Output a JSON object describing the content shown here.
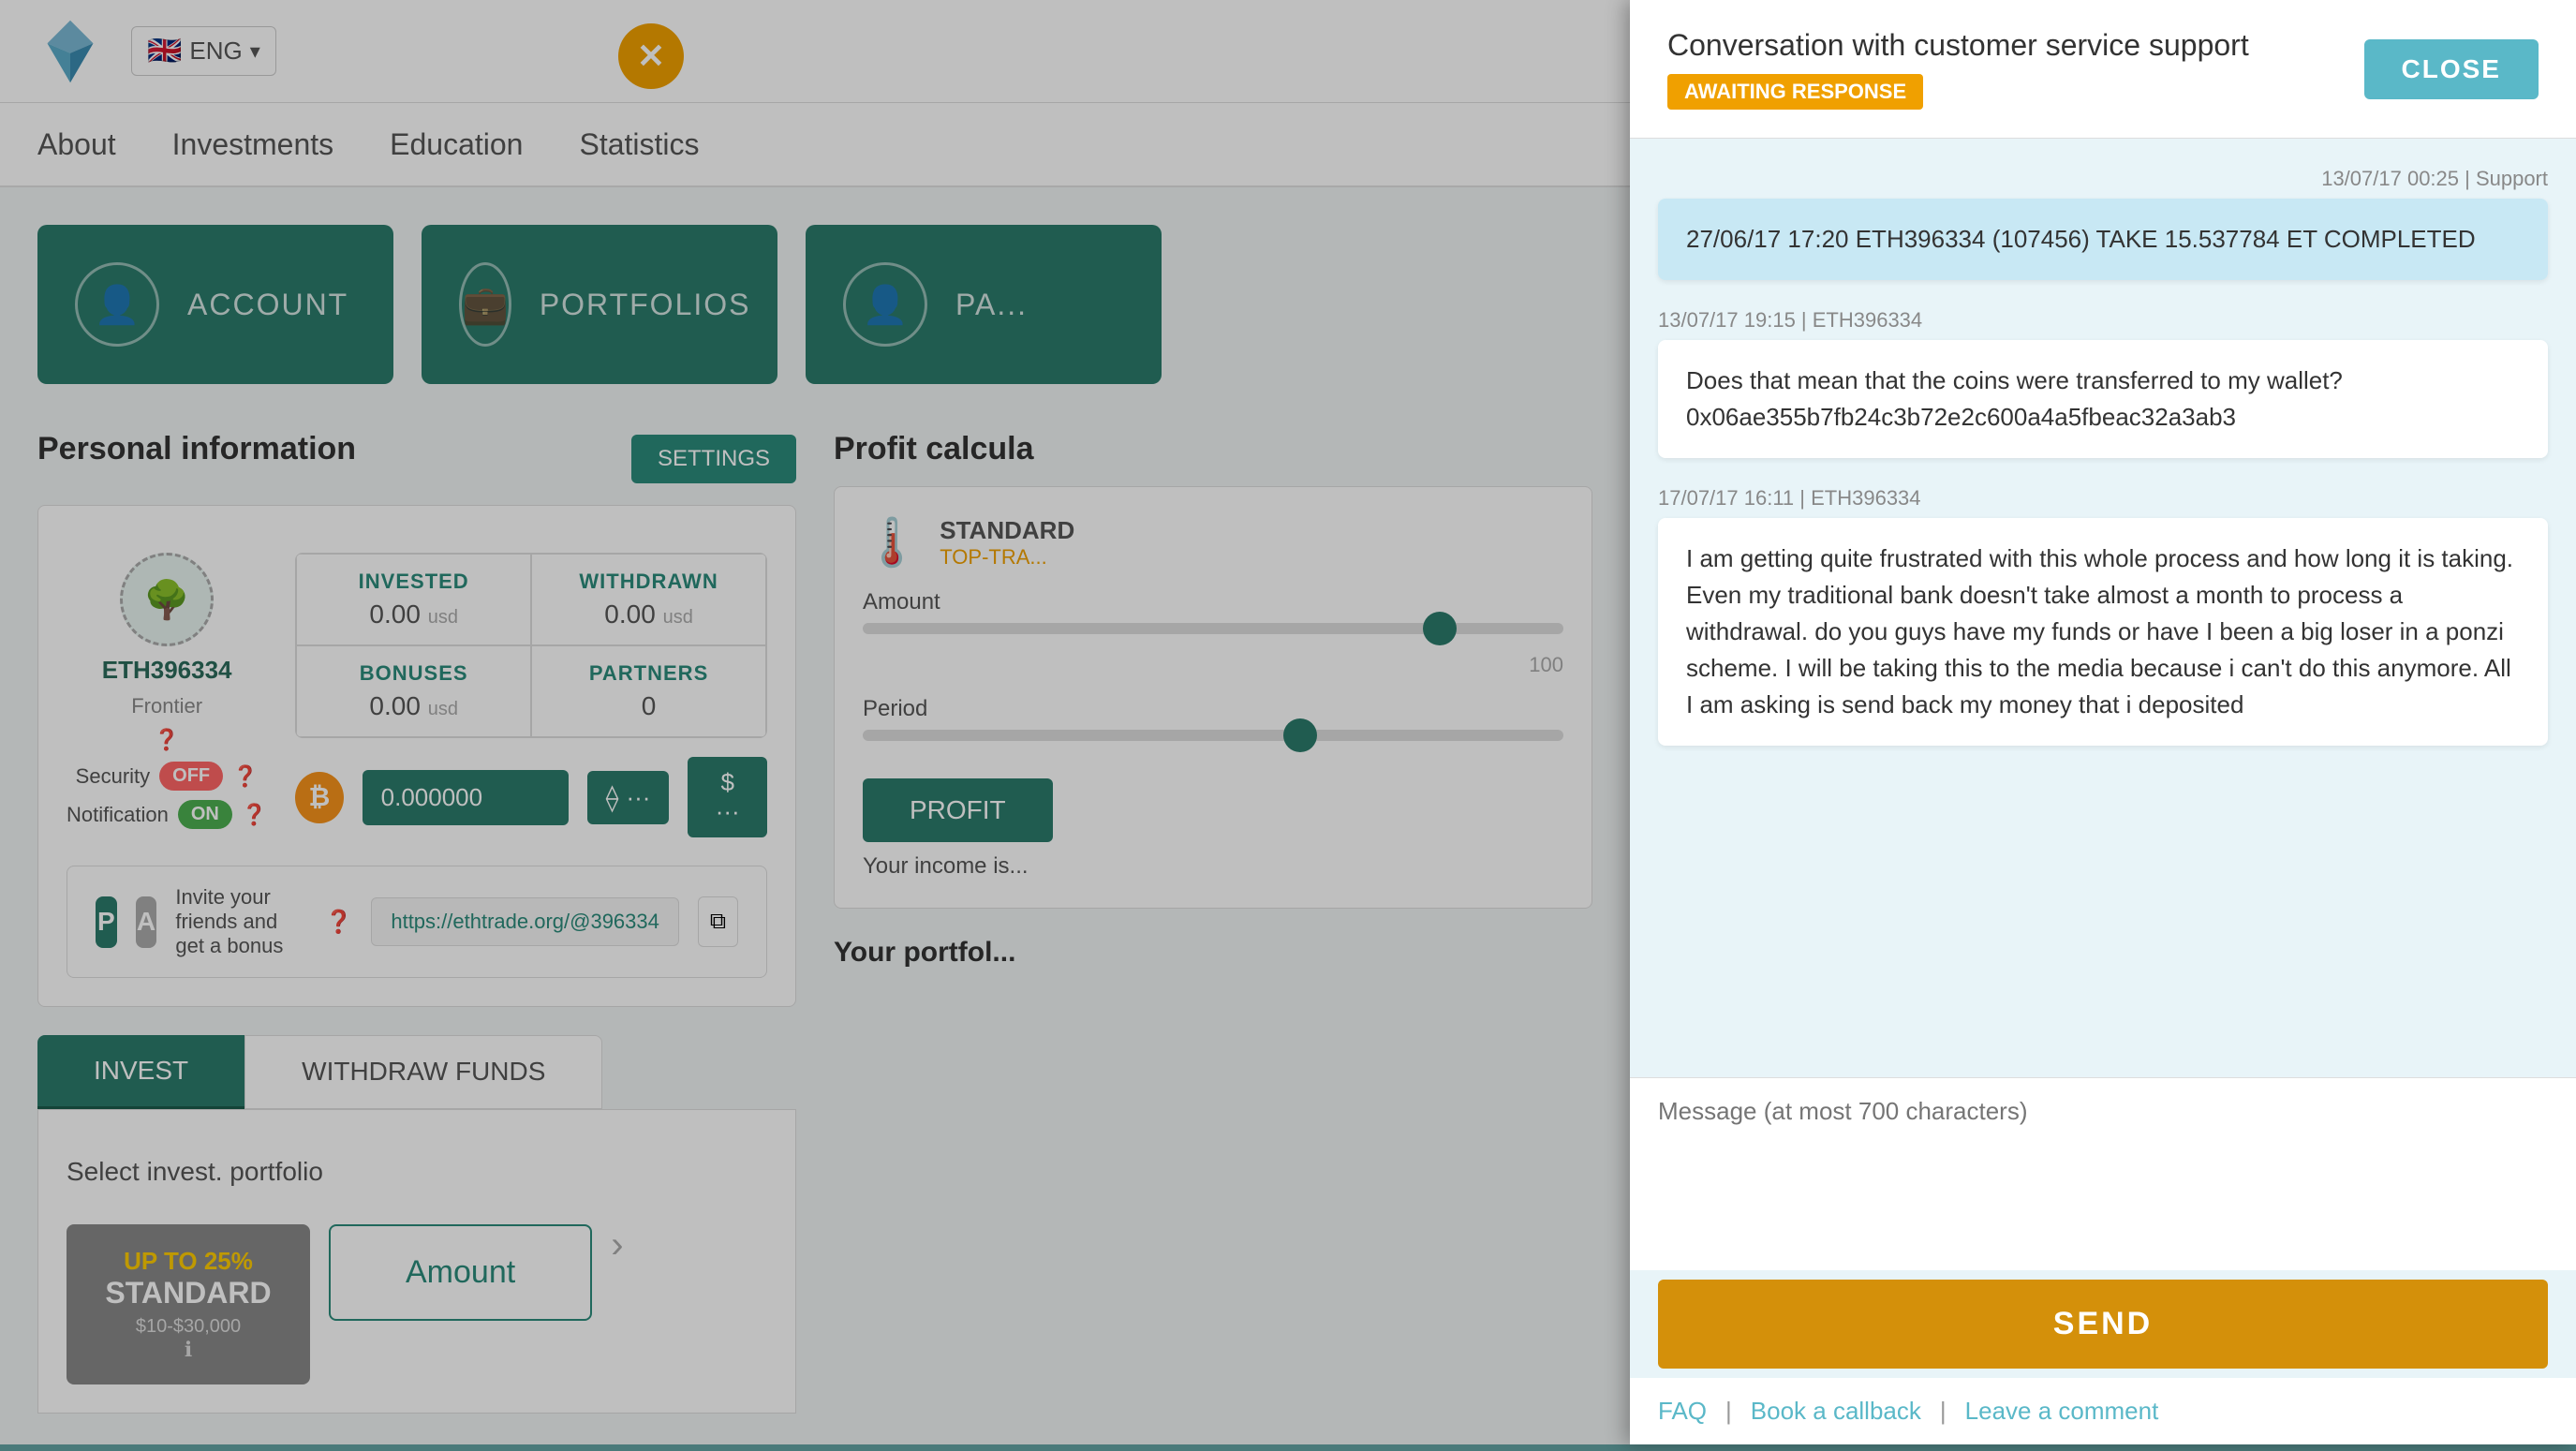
{
  "header": {
    "lang": "ENG",
    "close_x": "✕"
  },
  "nav": {
    "items": [
      "About",
      "Investments",
      "Education",
      "Statistics"
    ]
  },
  "cards": [
    {
      "label": "ACCOUNT",
      "icon": "👤"
    },
    {
      "label": "PORTFOLIOS",
      "icon": "💼"
    },
    {
      "label": "PA...",
      "icon": "👤"
    }
  ],
  "personal": {
    "title": "Personal information",
    "settings_label": "SETTINGS",
    "username": "ETH396334",
    "tier": "Frontier",
    "security_label": "Security",
    "notification_label": "Notification",
    "toggle_off": "OFF",
    "toggle_on": "ON",
    "invested_label": "INVESTED",
    "withdrawn_label": "WITHDRAWN",
    "invested_value": "0.00",
    "invested_unit": "usd",
    "withdrawn_value": "0.00",
    "withdrawn_unit": "usd",
    "bonuses_label": "BONUSES",
    "partners_label": "PARTNERS",
    "bonuses_value": "0.00",
    "bonuses_unit": "usd",
    "partners_value": "0",
    "balance": "0.000000",
    "referral_invite": "Invite your friends and get a bonus",
    "referral_link": "https://ethtrade.org/@396334",
    "p_label": "P",
    "a_label": "A"
  },
  "bottom_tabs": {
    "invest_label": "INVEST",
    "withdraw_label": "WITHDRAW FUNDS",
    "select_portfolio_label": "Select invest. portfolio",
    "standard_name": "STANDARD",
    "standard_range": "$10-$30,000",
    "standard_pct": "UP TO 25%",
    "amount_label": "Amount"
  },
  "profit": {
    "title": "Profit calcula",
    "standard_label": "STANDARD",
    "top_trade_label": "TOP-TRA...",
    "amount_label": "Amount",
    "period_label": "Period",
    "profit_btn": "PROFIT",
    "income_text": "Your income is..."
  },
  "your_portfolio": {
    "title": "Your portfol..."
  },
  "chat": {
    "title": "Conversation with customer service support",
    "awaiting": "AWAITING RESPONSE",
    "close_label": "CLOSE",
    "messages": [
      {
        "id": 1,
        "timestamp": "13/07/17 00:25 | Support",
        "type": "support",
        "text": "27/06/17 17:20 ETH396334 (107456) TAKE 15.537784 ET COMPLETED"
      },
      {
        "id": 2,
        "timestamp": "13/07/17 19:15 | ETH396334",
        "type": "user",
        "text": "Does that mean that the coins were transferred to my wallet? 0x06ae355b7fb24c3b72e2c600a4a5fbeac32a3ab3"
      },
      {
        "id": 3,
        "timestamp": "17/07/17 16:11 | ETH396334",
        "type": "user",
        "text": "I am getting quite frustrated with this whole process and how long it is taking. Even my traditional bank doesn't take almost a month to process a withdrawal. do you guys have my funds or have I been a big loser in a ponzi scheme. I will be taking this to the media because i can't do this anymore. All I am asking is send back my money that i deposited"
      }
    ],
    "message_placeholder": "Message (at most 700 characters)",
    "send_label": "SEND",
    "faq_label": "FAQ",
    "book_callback_label": "Book a callback",
    "leave_comment_label": "Leave a comment"
  }
}
